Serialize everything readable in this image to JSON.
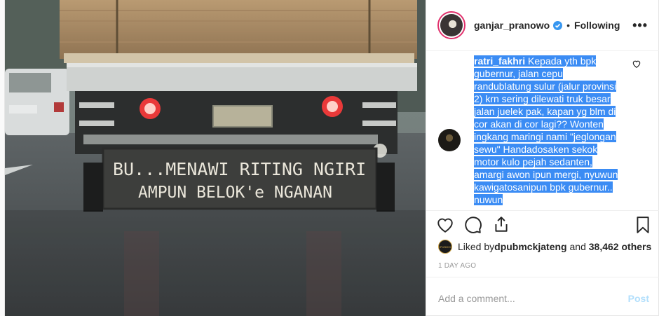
{
  "header": {
    "username": "ganjar_pranowo",
    "separator": "•",
    "follow_status": "Following",
    "more": "•••"
  },
  "photo": {
    "sign_line_1": "BU...MENAWI RITING NGIRI",
    "sign_line_2": "AMPUN BELOK'e NGANAN"
  },
  "comment": {
    "username": "ratri_fakhri",
    "lines": [
      " Kepada yth bpk",
      "gubernur, jalan cepu",
      "randublatung sulur (jalur provinsi",
      "2) krn sering dilewati truk besar",
      "jalan juelek pak, kapan yg blm di",
      "cor akan di cor lagi?? Wonten",
      "ingkang maringi nami \"jeglongan",
      "sewu\" Handadosaken sekok",
      "motor kulo pejah sedanten,",
      "amargi awon ipun mergi, nyuwun",
      "kawigatosanipun bpk gubernur..",
      "nuwun"
    ]
  },
  "likes": {
    "prefix": "Liked by ",
    "user": "dpubmckjateng",
    "middle": " and ",
    "count": "38,462 others",
    "avatar_text": "DPUBMCK"
  },
  "time": "1 DAY AGO",
  "add_comment": {
    "placeholder": "Add a comment...",
    "post_label": "Post"
  },
  "colors": {
    "highlight": "#3b8cf4",
    "verified": "#3897f0",
    "post_disabled": "#b2dffc"
  }
}
